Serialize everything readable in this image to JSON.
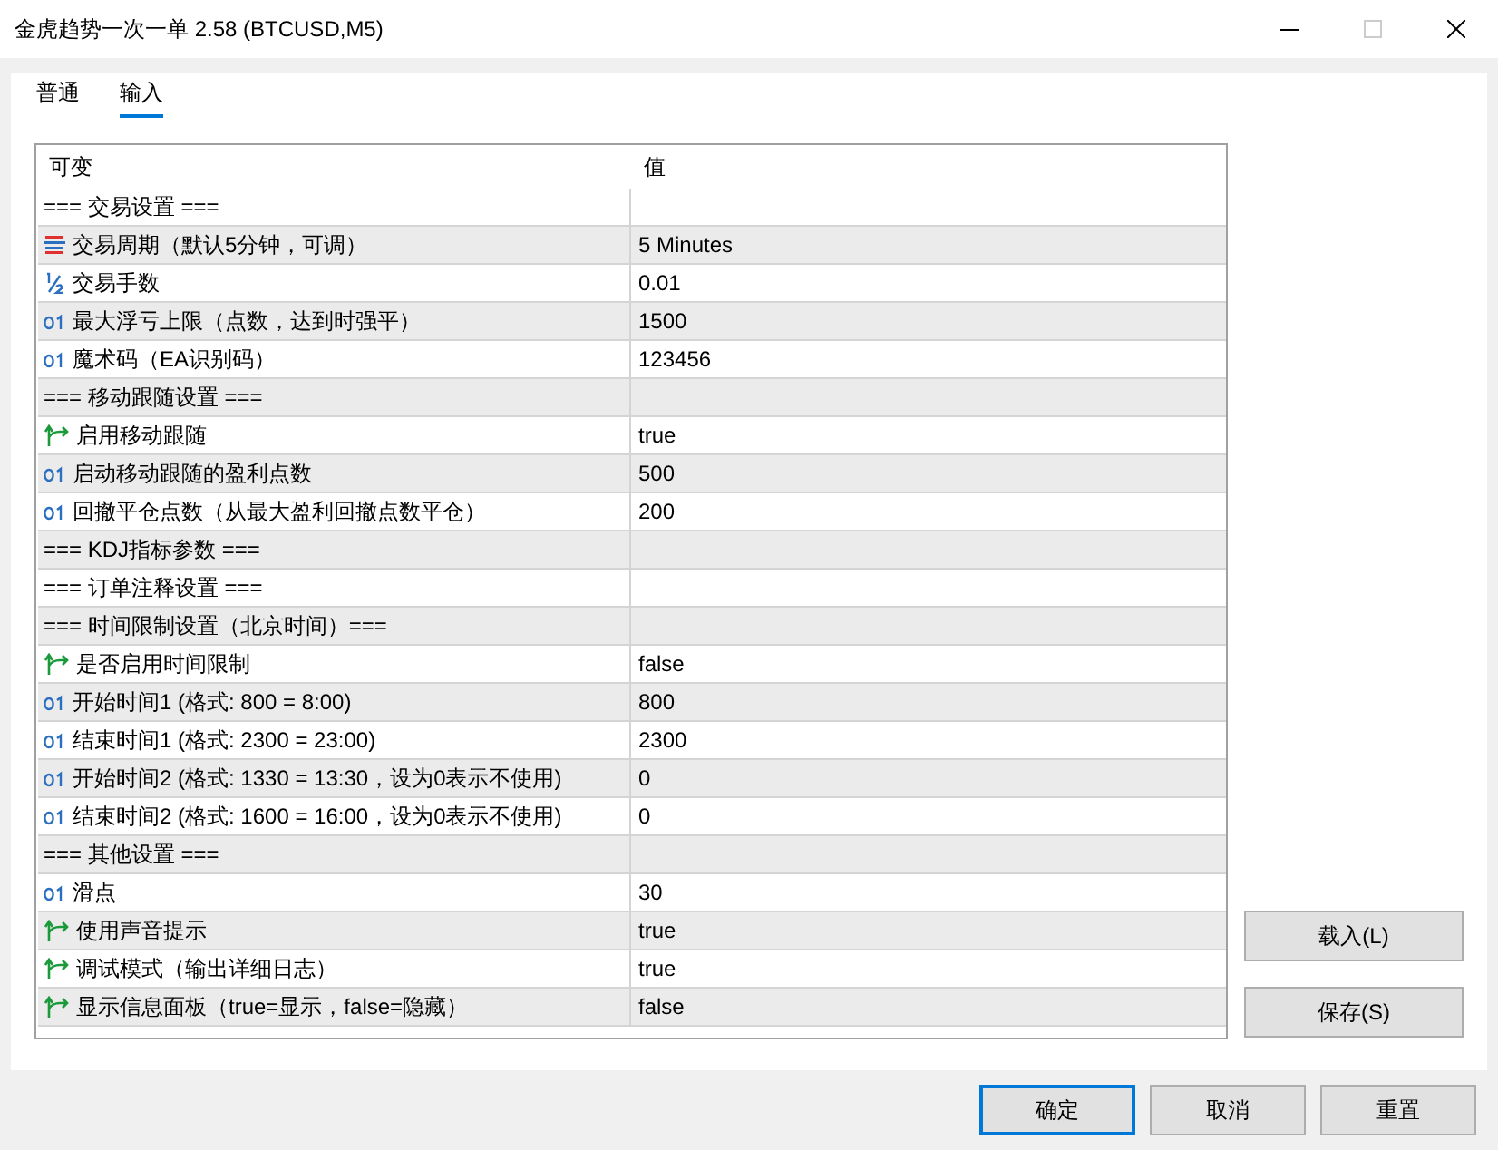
{
  "window": {
    "title": "金虎趋势一次一单 2.58 (BTCUSD,M5)"
  },
  "tabs": [
    {
      "label": "普通",
      "selected": false
    },
    {
      "label": "输入",
      "selected": true
    }
  ],
  "table": {
    "columns": [
      "可变",
      "值"
    ],
    "rows": [
      {
        "kind": "section",
        "name": "=== 交易设置 ==="
      },
      {
        "kind": "enum",
        "name": "交易周期（默认5分钟，可调）",
        "value": "5 Minutes"
      },
      {
        "kind": "double",
        "name": "交易手数",
        "value": "0.01"
      },
      {
        "kind": "int",
        "name": "最大浮亏上限（点数，达到时强平）",
        "value": "1500"
      },
      {
        "kind": "int",
        "name": "魔术码（EA识别码）",
        "value": "123456"
      },
      {
        "kind": "section",
        "name": "=== 移动跟随设置 ==="
      },
      {
        "kind": "bool",
        "name": "启用移动跟随",
        "value": "true"
      },
      {
        "kind": "int",
        "name": "启动移动跟随的盈利点数",
        "value": "500"
      },
      {
        "kind": "int",
        "name": "回撤平仓点数（从最大盈利回撤点数平仓）",
        "value": "200"
      },
      {
        "kind": "section",
        "name": "=== KDJ指标参数 ==="
      },
      {
        "kind": "section",
        "name": "=== 订单注释设置 ==="
      },
      {
        "kind": "section",
        "name": "=== 时间限制设置（北京时间）==="
      },
      {
        "kind": "bool",
        "name": "是否启用时间限制",
        "value": "false"
      },
      {
        "kind": "int",
        "name": "开始时间1 (格式: 800 = 8:00)",
        "value": "800"
      },
      {
        "kind": "int",
        "name": "结束时间1 (格式: 2300 = 23:00)",
        "value": "2300"
      },
      {
        "kind": "int",
        "name": "开始时间2 (格式: 1330 = 13:30，设为0表示不使用)",
        "value": "0"
      },
      {
        "kind": "int",
        "name": "结束时间2 (格式: 1600 = 16:00，设为0表示不使用)",
        "value": "0"
      },
      {
        "kind": "section",
        "name": "=== 其他设置 ==="
      },
      {
        "kind": "int",
        "name": "滑点",
        "value": "30"
      },
      {
        "kind": "bool",
        "name": "使用声音提示",
        "value": "true"
      },
      {
        "kind": "bool",
        "name": "调试模式（输出详细日志）",
        "value": "true"
      },
      {
        "kind": "bool",
        "name": "显示信息面板（true=显示，false=隐藏）",
        "value": "false"
      }
    ]
  },
  "side_buttons": [
    "载入(L)",
    "保存(S)"
  ],
  "buttons": [
    {
      "label": "确定",
      "focused": true
    },
    {
      "label": "取消",
      "focused": false
    },
    {
      "label": "重置",
      "focused": false
    }
  ]
}
